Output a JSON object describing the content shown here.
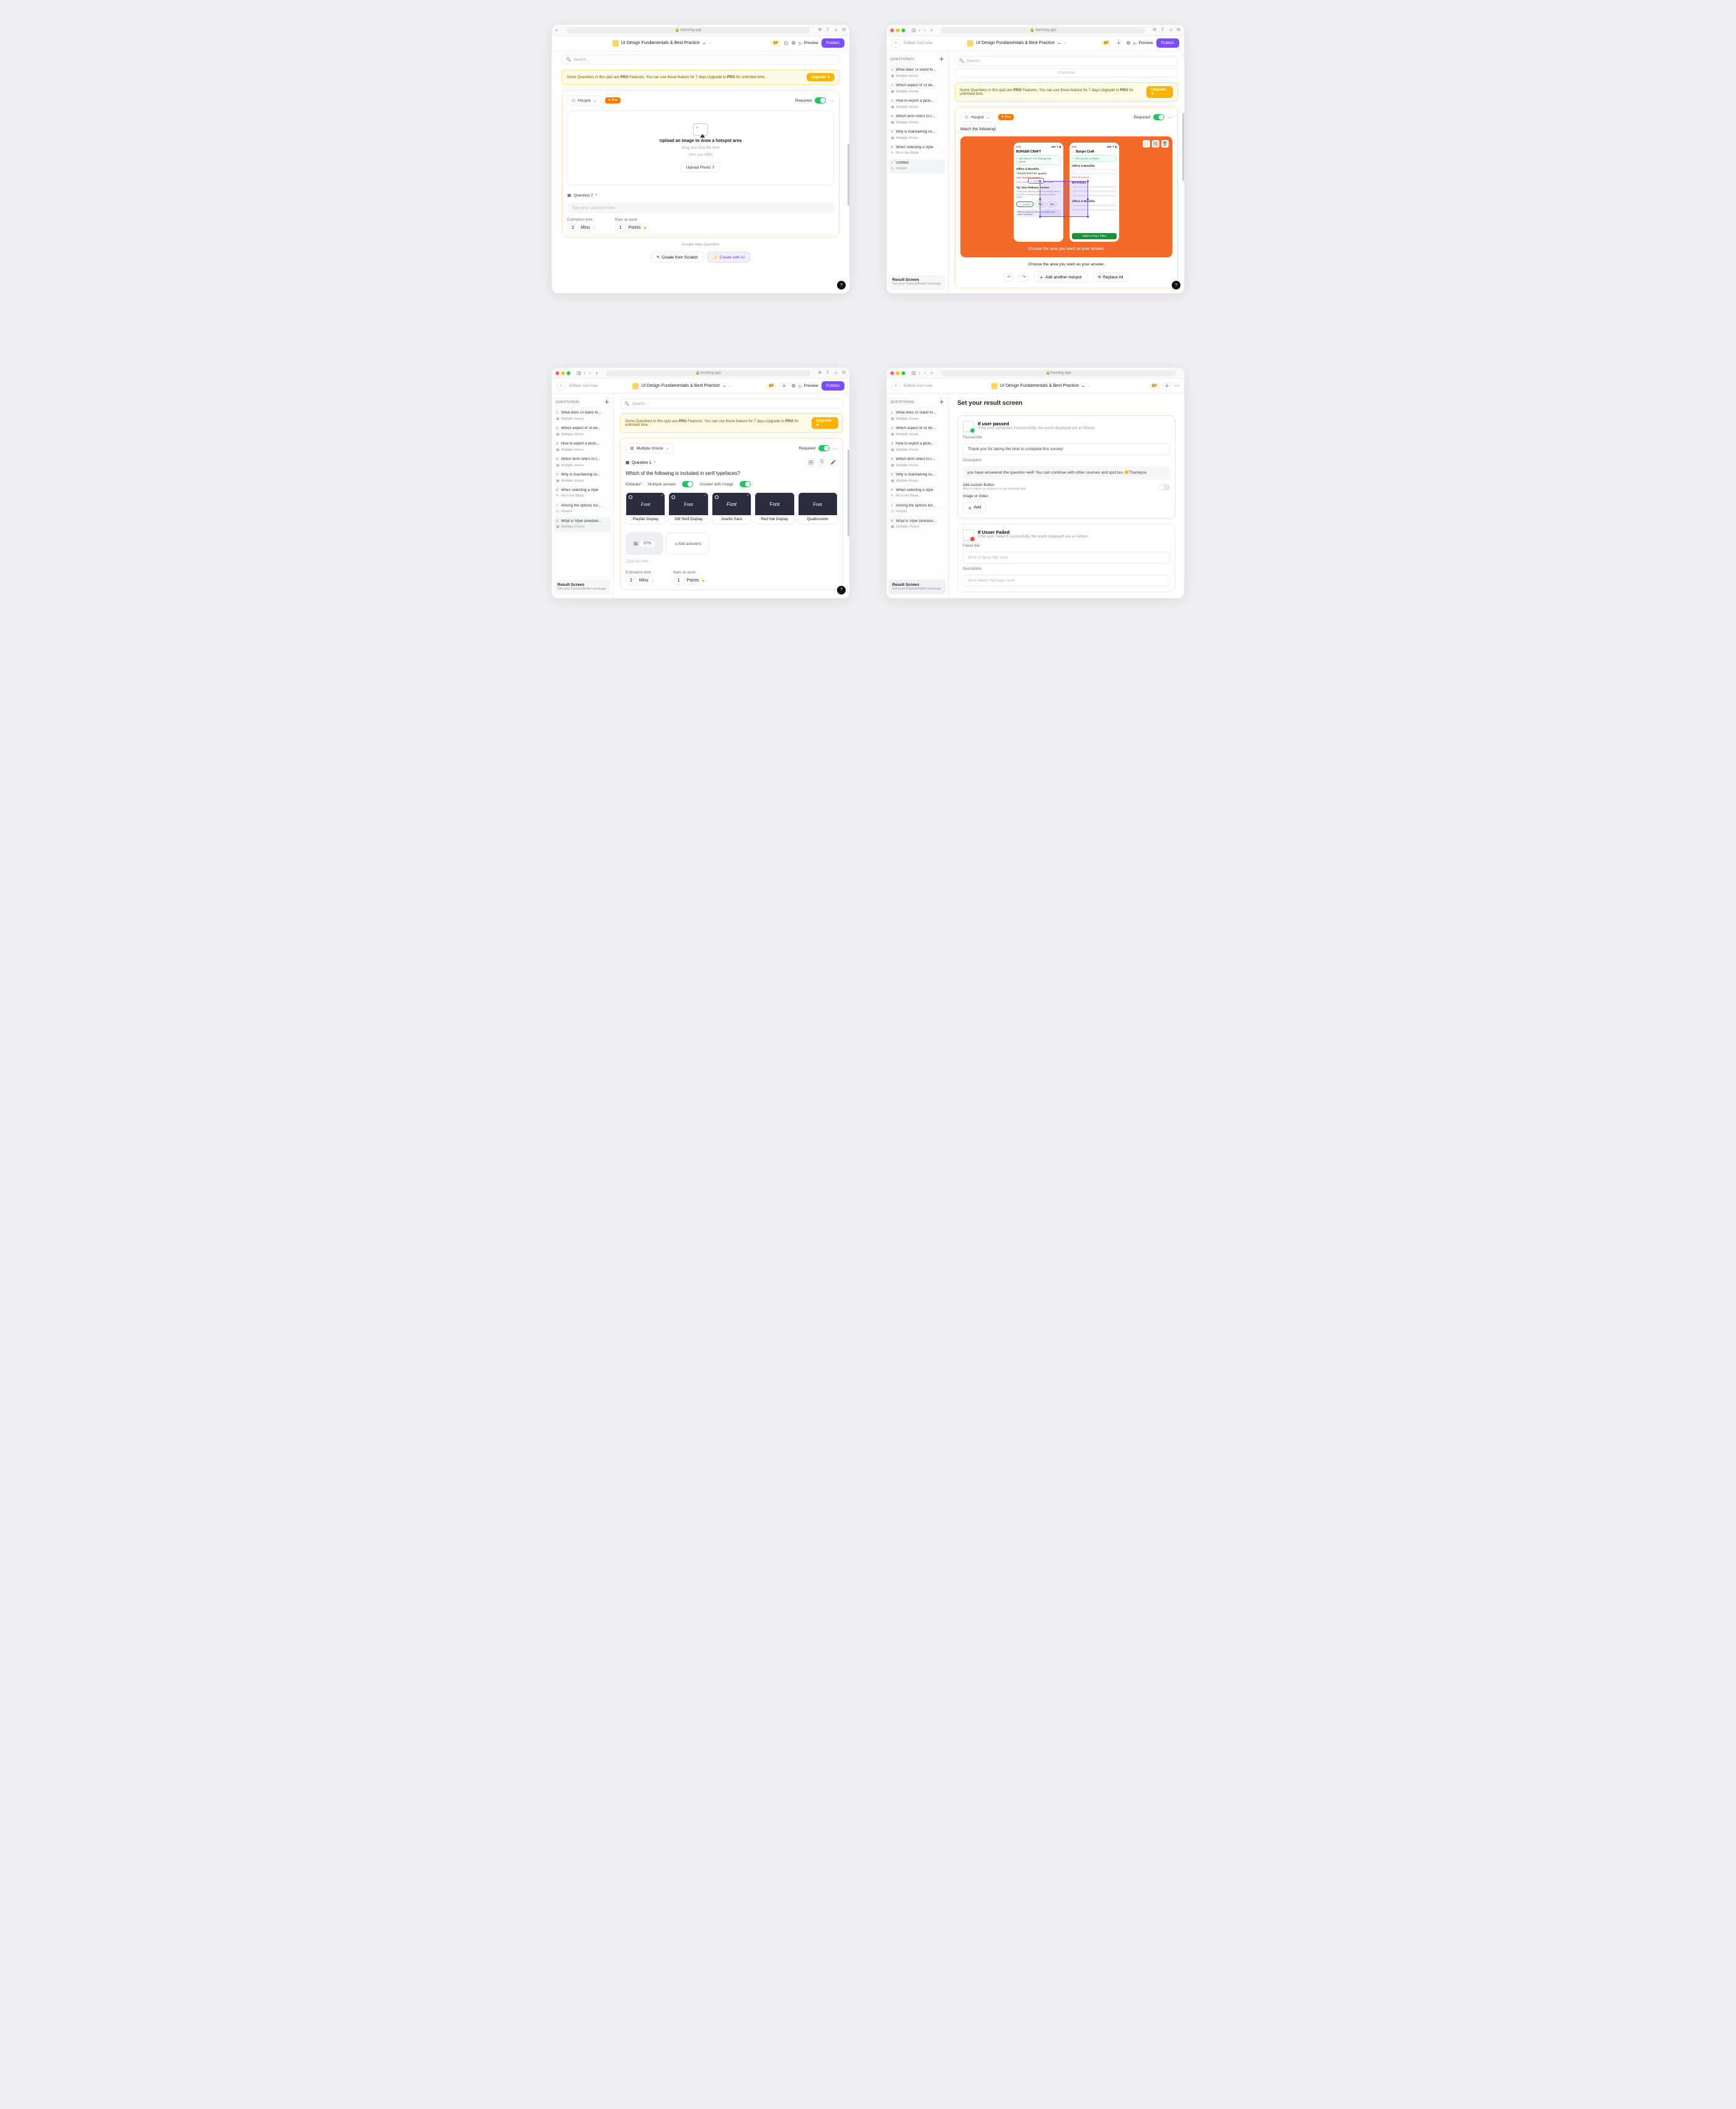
{
  "chrome": {
    "url": "trenning.app"
  },
  "appbar": {
    "edited": "Edited Just now",
    "title": "UI Design Fundamentals & Best Practice",
    "badge": "BF",
    "preview": "Preview",
    "publish": "Publish"
  },
  "search": {
    "placeholder": "Search..."
  },
  "banner": {
    "text_pre": "Some Questions in this quiz are ",
    "pro1": "PRO",
    "text_mid": " Features. You can use these feature for 7 days.Upgrade to ",
    "pro2": "PRO",
    "text_post": " for unlimited time.",
    "btn": "Upgrade"
  },
  "sidebarA": {
    "head7": "QUESTION(7)",
    "head8": "QUESTION(8)",
    "items": [
      {
        "num": "1",
        "title": "What does UI stand fo...",
        "type": "Multiple choice"
      },
      {
        "num": "2",
        "title": "Which aspect of UI de...",
        "type": "Multiple choice"
      },
      {
        "num": "3",
        "title": "How to export a pictu...",
        "type": "Multiple choice"
      },
      {
        "num": "4",
        "title": "Which term refers to t...",
        "type": "Multiple choice"
      },
      {
        "num": "5",
        "title": "Why is maintaining co...",
        "type": "Multiple choice"
      },
      {
        "num": "6",
        "title": "When selecting a style",
        "type": "Fill in the Blank"
      },
      {
        "num": "7",
        "title": "Untitled",
        "type": "Hospot"
      },
      {
        "num": "7b",
        "title": "Among the options list...",
        "type": "Hospot"
      },
      {
        "num": "8",
        "title": "What is Style Direction...",
        "type": "Multiple Choice"
      }
    ],
    "result": {
      "t": "Result Screen",
      "s": "Set your Passed/failed message"
    }
  },
  "panelA": {
    "chip": "Hospot",
    "pro": "Pro",
    "required": "Required",
    "upload": {
      "l1": "Upload an image to draw a hotspot area",
      "l2": "Drag and drop file here",
      "l3": "(Max size 5MB)",
      "btn": "Upload Photo"
    },
    "q7": "Question 7",
    "q7ph": "Type your question here",
    "est": "Estimation time",
    "mark": "Mark as point",
    "mins": "Mins",
    "points": "Points",
    "val2": "2",
    "val1": "1",
    "continue": "Continue",
    "createNew": "Create new Question",
    "scratch": "Create from Scratch",
    "ai": "Create with AI"
  },
  "panelB": {
    "match": "Match the following!",
    "phone1": {
      "title": "BURGER CRAFT",
      "card": "150 Joined! +9% Change this month",
      "sec1": "Offers & Benefits",
      "offer": "\"CRUZESPIRIT39\" applied!",
      "link": "Offer Benefits applied",
      "free": "Free delivery Extra ₹59 with Zone",
      "tip": "Tip Your Delivery Partner",
      "tiptxt": "Thank your delivery partner by leaving them a tip 100% of the tip will go to your delivery partner",
      "t10": "₹10",
      "t20": "₹20",
      "t30": "₹30",
      "correct": "Correct",
      "q": "Where would you like us to deliver your order Yummies?"
    },
    "phone2": {
      "title": "Burger Craft",
      "card": "TCR Joined! on Home",
      "sec1": "Offers & Benefits",
      "input": "Enter ORCI! Choose",
      "view": "View all coupon",
      "bill": "Bill Details",
      "sub": "Total Bill",
      "gst": "GST + Restaurant",
      "del": "Delivery Partner",
      "topay": "To Pay",
      "btn": "Slide to Pay | ₹854"
    },
    "cap": "Choose the area you want as your answer.",
    "add": "Add another hotspot",
    "replace": "Replace All"
  },
  "panelC": {
    "chip": "Multiple choice",
    "q1": "Question 1",
    "qtext": "Which of the following is included in serif typefaces?",
    "choices": "Choises",
    "multi": "Multiple answer",
    "imgans": "Answer with image",
    "fonts": [
      {
        "word": "Font",
        "label": "Playfair Display",
        "fam": "'Times New Roman',serif",
        "it": true
      },
      {
        "word": "Font",
        "label": "DM Serif Display",
        "fam": "Georgia,serif",
        "it": false
      },
      {
        "word": "Font",
        "label": "Josefin Sans",
        "fam": "'Arial Narrow',sans-serif",
        "it": true
      },
      {
        "word": "Font",
        "label": "Red Hat Display",
        "fam": "Arial,sans-serif",
        "it": false
      },
      {
        "word": "Font",
        "label": "Quattrocento",
        "fam": "Georgia,serif",
        "it": false
      }
    ],
    "pct": "97%",
    "addans": "Add answers",
    "typeans": "Type Answer..."
  },
  "panelD": {
    "title": "Set your result screen",
    "pass": {
      "h": "If user passed",
      "s": "If the user completes it successfully, the words displayed are as follows"
    },
    "passTitle": "Passed title",
    "passVal": "Thank you for taking the time to complete this survey!",
    "desc": "Description",
    "descVal": "you have answered the question well! You can continue with other courses and quizzes.👏Thankyou",
    "custom": "Add custom Button",
    "customSub": "Add a button to redirect to an external link",
    "imgvid": "Image or Video",
    "add": "Add",
    "fail": {
      "h": "If Usser Failed",
      "s": "If the user Failed it successfully, the words displayed are as follows"
    },
    "failTitle": "Failed title",
    "failPh": "Write a failed title here",
    "failDesc": "Description",
    "failDescPh": "Write failed message here"
  }
}
